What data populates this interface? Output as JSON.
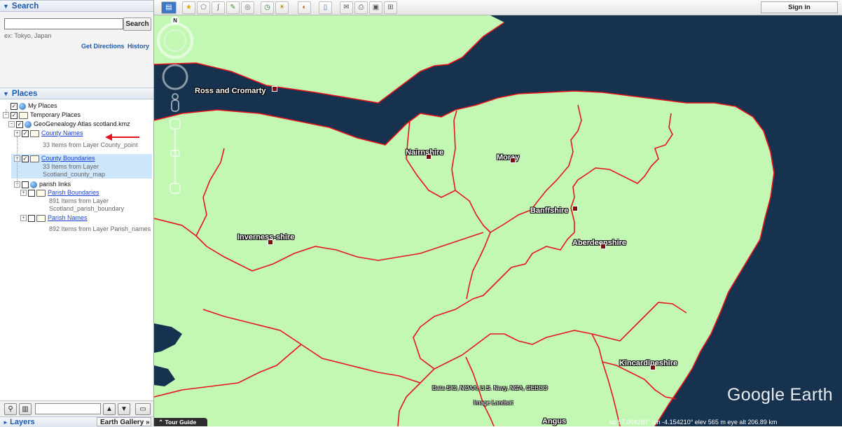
{
  "search": {
    "header": "Search",
    "input_value": "",
    "button": "Search",
    "hint": "ex: Tokyo, Japan",
    "get_directions": "Get Directions",
    "history": "History"
  },
  "places": {
    "header": "Places",
    "items": [
      {
        "label": "My Places"
      },
      {
        "label": "Temporary Places"
      },
      {
        "label": "GeoGenealogy Atlas scotland.kmz"
      },
      {
        "label": "County Names",
        "sub": "33 Items from Layer County_point"
      },
      {
        "label": "County Boundaries",
        "sub1": "33 Items from Layer",
        "sub2": "Scotland_county_map"
      },
      {
        "label": "parish links"
      },
      {
        "label": "Parish Boundaries",
        "sub1": "891 Items from Layer",
        "sub2": "Scotland_parish_boundary"
      },
      {
        "label": "Parish Names",
        "sub": "892 Items from Layer Parish_names"
      }
    ]
  },
  "bottom": {
    "layers": "Layers",
    "earth_gallery": "Earth Gallery »"
  },
  "toolbar": {
    "sign_in": "Sign in"
  },
  "map": {
    "labels": {
      "ross": "Ross and Cromarty",
      "nairn": "Nairnshire",
      "moray": "Moray",
      "banff": "Banffshire",
      "inverness": "Inverness-shire",
      "aberdeen": "Aberdeenshire",
      "kincardine": "Kincardineshire",
      "angus": "Angus"
    },
    "attribution1": "Data SIO, NOAA, U.S. Navy, NGA, GEBCO",
    "attribution2": "Image Landsat",
    "brand": "Google Earth",
    "tour_guide": "Tour Guide",
    "status": "lat  57.069280°  lon  -4.154210°  elev   565 m     eye alt 206.89 km",
    "colors": {
      "land": "#c3f7b4",
      "sea": "#16324e",
      "border": "#e8141c"
    }
  }
}
